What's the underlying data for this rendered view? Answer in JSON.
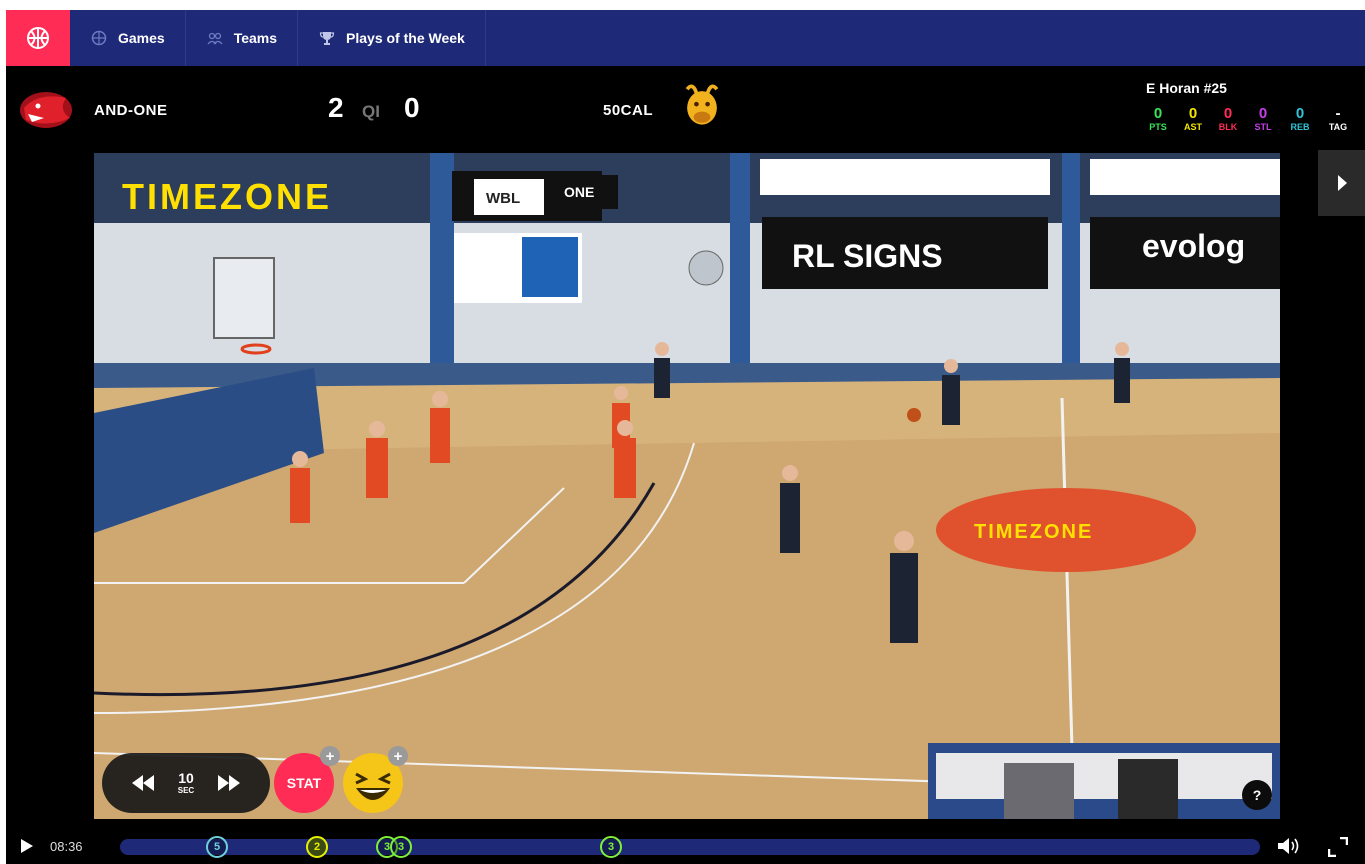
{
  "nav": {
    "items": [
      {
        "label": "Games",
        "icon": "basketball-icon"
      },
      {
        "label": "Teams",
        "icon": "team-icon"
      },
      {
        "label": "Plays of the Week",
        "icon": "trophy-icon"
      }
    ]
  },
  "scoreboard": {
    "home": {
      "name": "AND-ONE",
      "score": "2",
      "logo": "panther-logo"
    },
    "away": {
      "name": "50CAL",
      "score": "0",
      "logo": "bull-logo"
    },
    "quarter": "QI"
  },
  "player": {
    "name": "E Horan #25",
    "stats": [
      {
        "value": "0",
        "label": "PTS",
        "color": "#39e35a"
      },
      {
        "value": "0",
        "label": "AST",
        "color": "#f2e600"
      },
      {
        "value": "0",
        "label": "BLK",
        "color": "#ff2d55"
      },
      {
        "value": "0",
        "label": "STL",
        "color": "#c640e8"
      },
      {
        "value": "0",
        "label": "REB",
        "color": "#2fc3d8"
      },
      {
        "value": "-",
        "label": "TAG",
        "color": "#ffffff"
      }
    ]
  },
  "video": {
    "banners": {
      "timezone_top": "TIMEZONE",
      "timezone_court": "TIMEZONE",
      "rl_signs": "RL SIGNS",
      "evologic": "evolog",
      "one": "ONE",
      "nbl": "WBL"
    }
  },
  "controls": {
    "skip_seconds": "10",
    "skip_unit": "SEC",
    "stat_label": "STAT",
    "plus_label": "+",
    "help_label": "?"
  },
  "playback": {
    "current_time": "08:36",
    "markers": [
      {
        "items": [
          "5"
        ],
        "style": "teal"
      },
      {
        "items": [
          "2"
        ],
        "style": "yellow"
      },
      {
        "items": [
          "3",
          "3"
        ],
        "style": "green"
      },
      {
        "items": [
          "3"
        ],
        "style": "green"
      }
    ]
  },
  "colors": {
    "nav_bg": "#1e2a78",
    "brand_pink": "#ff2d55",
    "timeline": "#1e2a78",
    "marker_green": "#7ef03a"
  }
}
